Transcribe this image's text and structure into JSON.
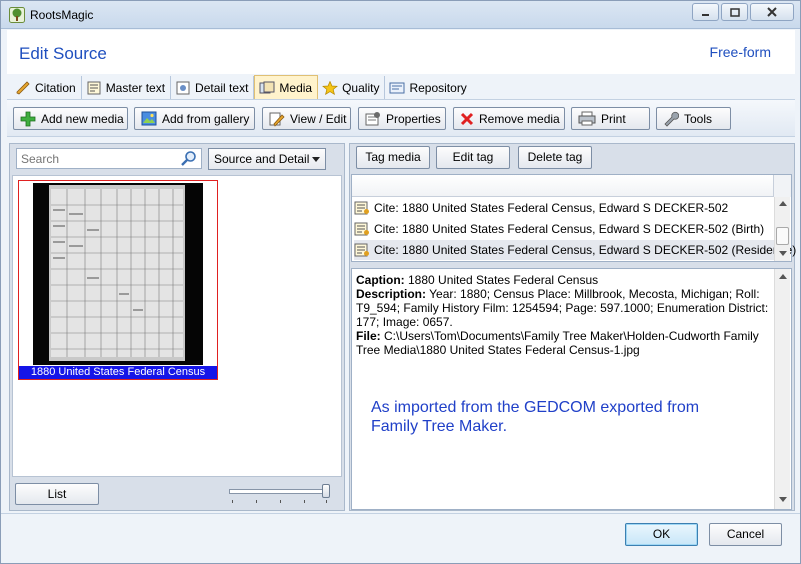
{
  "window": {
    "title": "RootsMagic",
    "controls": [
      "minimize",
      "maximize",
      "close"
    ]
  },
  "header": {
    "title": "Edit Source",
    "mode": "Free-form"
  },
  "tabs": [
    {
      "label": "Citation",
      "icon": "pencil-icon",
      "active": false
    },
    {
      "label": "Master text",
      "icon": "document-icon",
      "active": false
    },
    {
      "label": "Detail text",
      "icon": "detail-icon",
      "active": false
    },
    {
      "label": "Media",
      "icon": "media-icon",
      "active": true
    },
    {
      "label": "Quality",
      "icon": "star-icon",
      "active": false
    },
    {
      "label": "Repository",
      "icon": "repository-icon",
      "active": false
    }
  ],
  "toolbar": {
    "add_new_media": "Add new media",
    "add_from_gallery": "Add from gallery",
    "view_edit": "View / Edit",
    "properties": "Properties",
    "remove_media": "Remove media",
    "print": "Print",
    "tools": "Tools"
  },
  "left": {
    "search_placeholder": "Search",
    "filter_value": "Source and Detail",
    "thumbnail_caption": "1880 United States Federal Census",
    "list_button": "List"
  },
  "right": {
    "tag_media": "Tag media",
    "edit_tag": "Edit tag",
    "delete_tag": "Delete tag",
    "tags": [
      {
        "text": "Cite: 1880 United States Federal Census, Edward S DECKER-502",
        "selected": false
      },
      {
        "text": "Cite: 1880 United States Federal Census, Edward S DECKER-502 (Birth)",
        "selected": false
      },
      {
        "text": "Cite: 1880 United States Federal Census, Edward S DECKER-502 (Residence)",
        "selected": true
      }
    ],
    "detail": {
      "caption_label": "Caption:",
      "caption": "1880 United States Federal Census",
      "description_label": "Description:",
      "description": "Year: 1880; Census Place: Millbrook, Mecosta, Michigan; Roll: T9_594; Family History Film: 1254594; Page: 597.1000; Enumeration District: 177; Image: 0657.",
      "file_label": "File:",
      "file": "C:\\Users\\Tom\\Documents\\Family Tree Maker\\Holden-Cudworth Family Tree Media\\1880 United States Federal Census-1.jpg",
      "note": "As imported from the GEDCOM exported from Family Tree Maker."
    }
  },
  "footer": {
    "ok": "OK",
    "cancel": "Cancel"
  },
  "colors": {
    "accent_blue": "#1f4fbf",
    "selection_blue": "#1515e8",
    "active_tab": "#fff3cc"
  }
}
